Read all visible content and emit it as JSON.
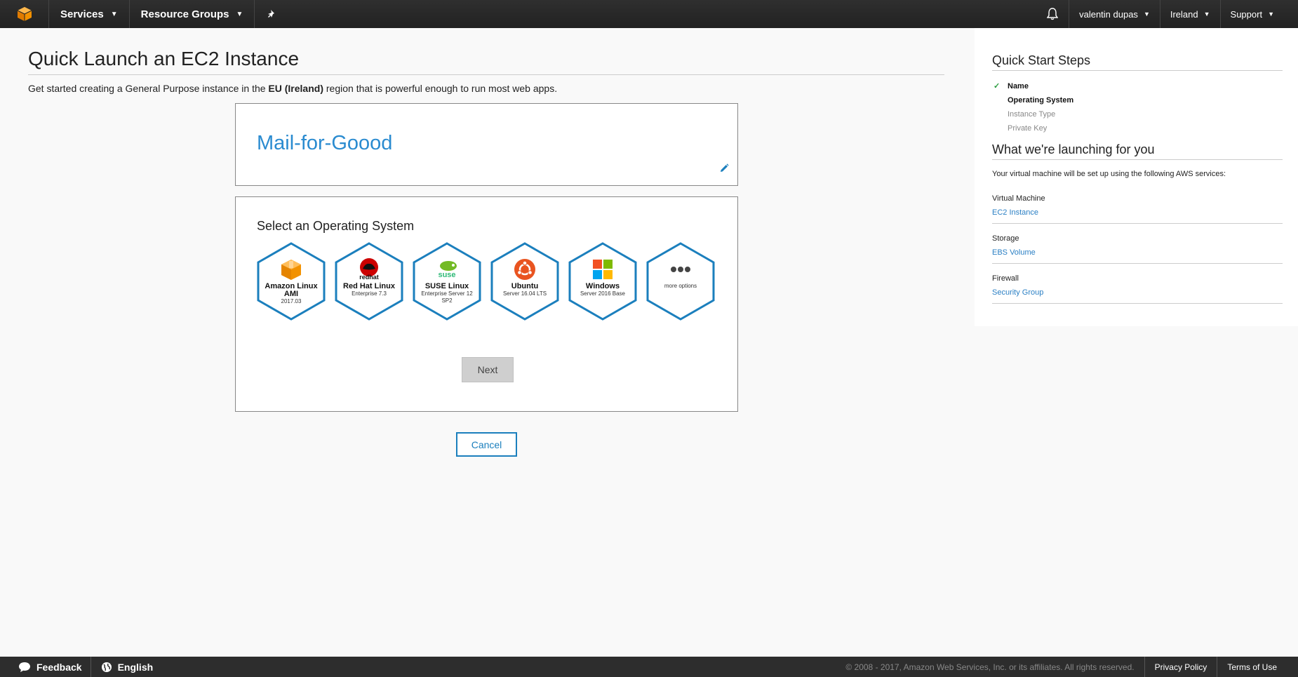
{
  "nav": {
    "services_label": "Services",
    "resource_groups_label": "Resource Groups",
    "user_label": "valentin dupas",
    "region_label": "Ireland",
    "support_label": "Support"
  },
  "main": {
    "title": "Quick Launch an EC2 Instance",
    "intro_before": "Get started creating a General Purpose instance in the ",
    "intro_region": "EU (Ireland)",
    "intro_after": " region that is powerful enough to run most web apps.",
    "instance_name": "Mail-for-Goood",
    "os_section_title": "Select an Operating System",
    "os_options": [
      {
        "name": "Amazon Linux AMI",
        "version": "2017.03",
        "icon": "amazon-box-icon"
      },
      {
        "name": "Red Hat Linux",
        "version": "Enterprise 7.3",
        "icon": "redhat-icon"
      },
      {
        "name": "SUSE Linux",
        "version": "Enterprise Server 12 SP2",
        "icon": "suse-icon"
      },
      {
        "name": "Ubuntu",
        "version": "Server 16.04 LTS",
        "icon": "ubuntu-icon"
      },
      {
        "name": "Windows",
        "version": "Server 2016 Base",
        "icon": "windows-icon"
      },
      {
        "name": "",
        "version": "more options",
        "icon": "more-dots-icon"
      }
    ],
    "redhat_logo_text": "redhat",
    "suse_logo_text": "suse",
    "next_label": "Next",
    "cancel_label": "Cancel"
  },
  "side": {
    "steps_title": "Quick Start Steps",
    "steps": [
      {
        "label": "Name",
        "state": "done"
      },
      {
        "label": "Operating System",
        "state": "active"
      },
      {
        "label": "Instance Type",
        "state": "pending"
      },
      {
        "label": "Private Key",
        "state": "pending"
      }
    ],
    "launch_title": "What we're launching for you",
    "launch_lead": "Your virtual machine will be set up using the following AWS services:",
    "services": [
      {
        "label": "Virtual Machine",
        "link": "EC2 Instance"
      },
      {
        "label": "Storage",
        "link": "EBS Volume"
      },
      {
        "label": "Firewall",
        "link": "Security Group"
      }
    ]
  },
  "footer": {
    "feedback_label": "Feedback",
    "language_label": "English",
    "copyright": "© 2008 - 2017, Amazon Web Services, Inc. or its affiliates. All rights reserved.",
    "privacy_label": "Privacy Policy",
    "terms_label": "Terms of Use"
  },
  "colors": {
    "accent_blue": "#2a8bd0",
    "hex_border": "#1b7fbd",
    "nav_bg": "#232323",
    "check_green": "#2a9d3f"
  }
}
